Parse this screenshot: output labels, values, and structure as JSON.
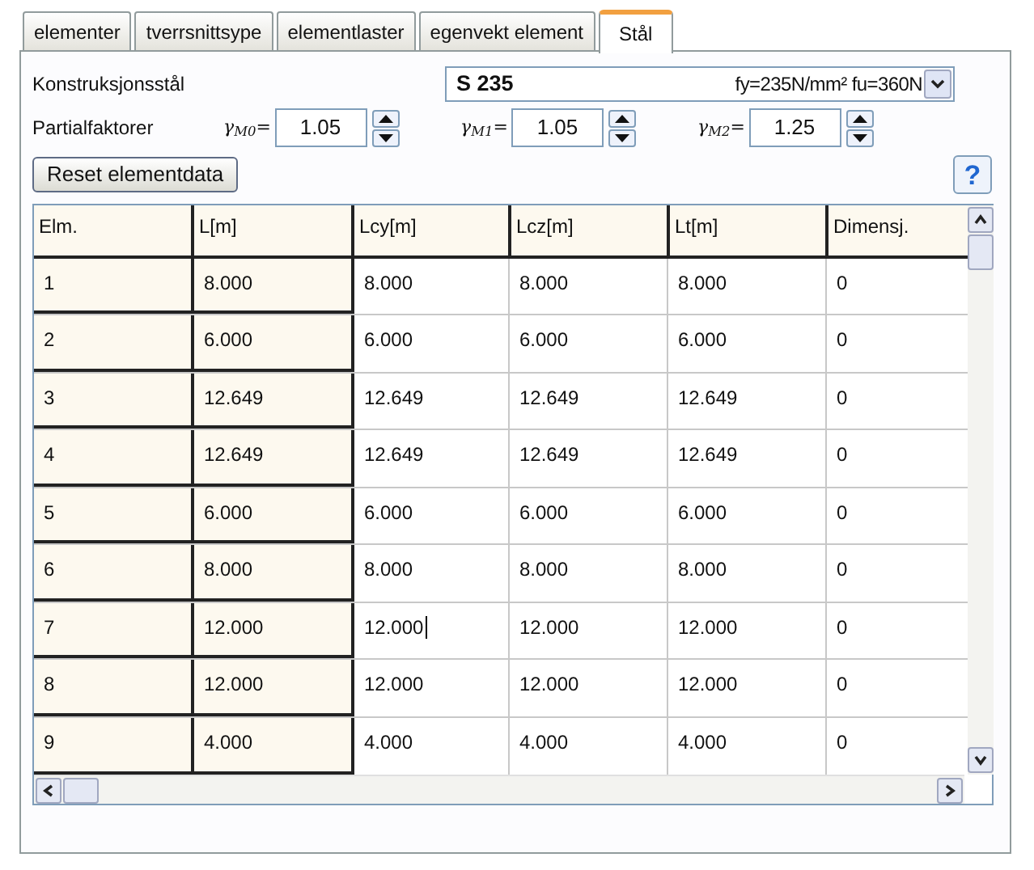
{
  "tabs": [
    {
      "label": "elementer",
      "selected": false
    },
    {
      "label": "tverrsnittsype",
      "selected": false
    },
    {
      "label": "elementlaster",
      "selected": false
    },
    {
      "label": "egenvekt element",
      "selected": false
    },
    {
      "label": "Stål",
      "selected": true
    }
  ],
  "steel": {
    "label": "Konstruksjonsstål",
    "value": "S 235",
    "detail": "fy=235N/mm² fu=360N"
  },
  "factors": {
    "label": "Partialfaktorer",
    "items": [
      {
        "label": "γ$_{M0}$=",
        "value": "1.05"
      },
      {
        "label": "γ$_{M1}$=",
        "value": "1.05"
      },
      {
        "label": "γ$_{M2}$=",
        "value": "1.25"
      }
    ]
  },
  "reset_button": "Reset elementdata",
  "help_button": "?",
  "table": {
    "columns": [
      "Elm.",
      "L[m]",
      "Lcy[m]",
      "Lcz[m]",
      "Lt[m]",
      "Dimensj."
    ],
    "rows": [
      {
        "cells": [
          {
            "text": "1",
            "editing": false
          },
          {
            "text": "8.000",
            "editing": false
          },
          {
            "text": "8.000",
            "editing": false
          },
          {
            "text": "8.000",
            "editing": false
          },
          {
            "text": "8.000",
            "editing": false
          },
          {
            "text": "0",
            "editing": false
          }
        ]
      },
      {
        "cells": [
          {
            "text": "2",
            "editing": false
          },
          {
            "text": "6.000",
            "editing": false
          },
          {
            "text": "6.000",
            "editing": false
          },
          {
            "text": "6.000",
            "editing": false
          },
          {
            "text": "6.000",
            "editing": false
          },
          {
            "text": "0",
            "editing": false
          }
        ]
      },
      {
        "cells": [
          {
            "text": "3",
            "editing": false
          },
          {
            "text": "12.649",
            "editing": false
          },
          {
            "text": "12.649",
            "editing": false
          },
          {
            "text": "12.649",
            "editing": false
          },
          {
            "text": "12.649",
            "editing": false
          },
          {
            "text": "0",
            "editing": false
          }
        ]
      },
      {
        "cells": [
          {
            "text": "4",
            "editing": false
          },
          {
            "text": "12.649",
            "editing": false
          },
          {
            "text": "12.649",
            "editing": false
          },
          {
            "text": "12.649",
            "editing": false
          },
          {
            "text": "12.649",
            "editing": false
          },
          {
            "text": "0",
            "editing": false
          }
        ]
      },
      {
        "cells": [
          {
            "text": "5",
            "editing": false
          },
          {
            "text": "6.000",
            "editing": false
          },
          {
            "text": "6.000",
            "editing": false
          },
          {
            "text": "6.000",
            "editing": false
          },
          {
            "text": "6.000",
            "editing": false
          },
          {
            "text": "0",
            "editing": false
          }
        ]
      },
      {
        "cells": [
          {
            "text": "6",
            "editing": false
          },
          {
            "text": "8.000",
            "editing": false
          },
          {
            "text": "8.000",
            "editing": false
          },
          {
            "text": "8.000",
            "editing": false
          },
          {
            "text": "8.000",
            "editing": false
          },
          {
            "text": "0",
            "editing": false
          }
        ]
      },
      {
        "cells": [
          {
            "text": "7",
            "editing": false
          },
          {
            "text": "12.000",
            "editing": false
          },
          {
            "text": "12.000",
            "editing": true
          },
          {
            "text": "12.000",
            "editing": false
          },
          {
            "text": "12.000",
            "editing": false
          },
          {
            "text": "0",
            "editing": false
          }
        ]
      },
      {
        "cells": [
          {
            "text": "8",
            "editing": false
          },
          {
            "text": "12.000",
            "editing": false
          },
          {
            "text": "12.000",
            "editing": false
          },
          {
            "text": "12.000",
            "editing": false
          },
          {
            "text": "12.000",
            "editing": false
          },
          {
            "text": "0",
            "editing": false
          }
        ]
      },
      {
        "cells": [
          {
            "text": "9",
            "editing": false
          },
          {
            "text": "4.000",
            "editing": false
          },
          {
            "text": "4.000",
            "editing": false
          },
          {
            "text": "4.000",
            "editing": false
          },
          {
            "text": "4.000",
            "editing": false
          },
          {
            "text": "0",
            "editing": false
          }
        ]
      }
    ]
  }
}
